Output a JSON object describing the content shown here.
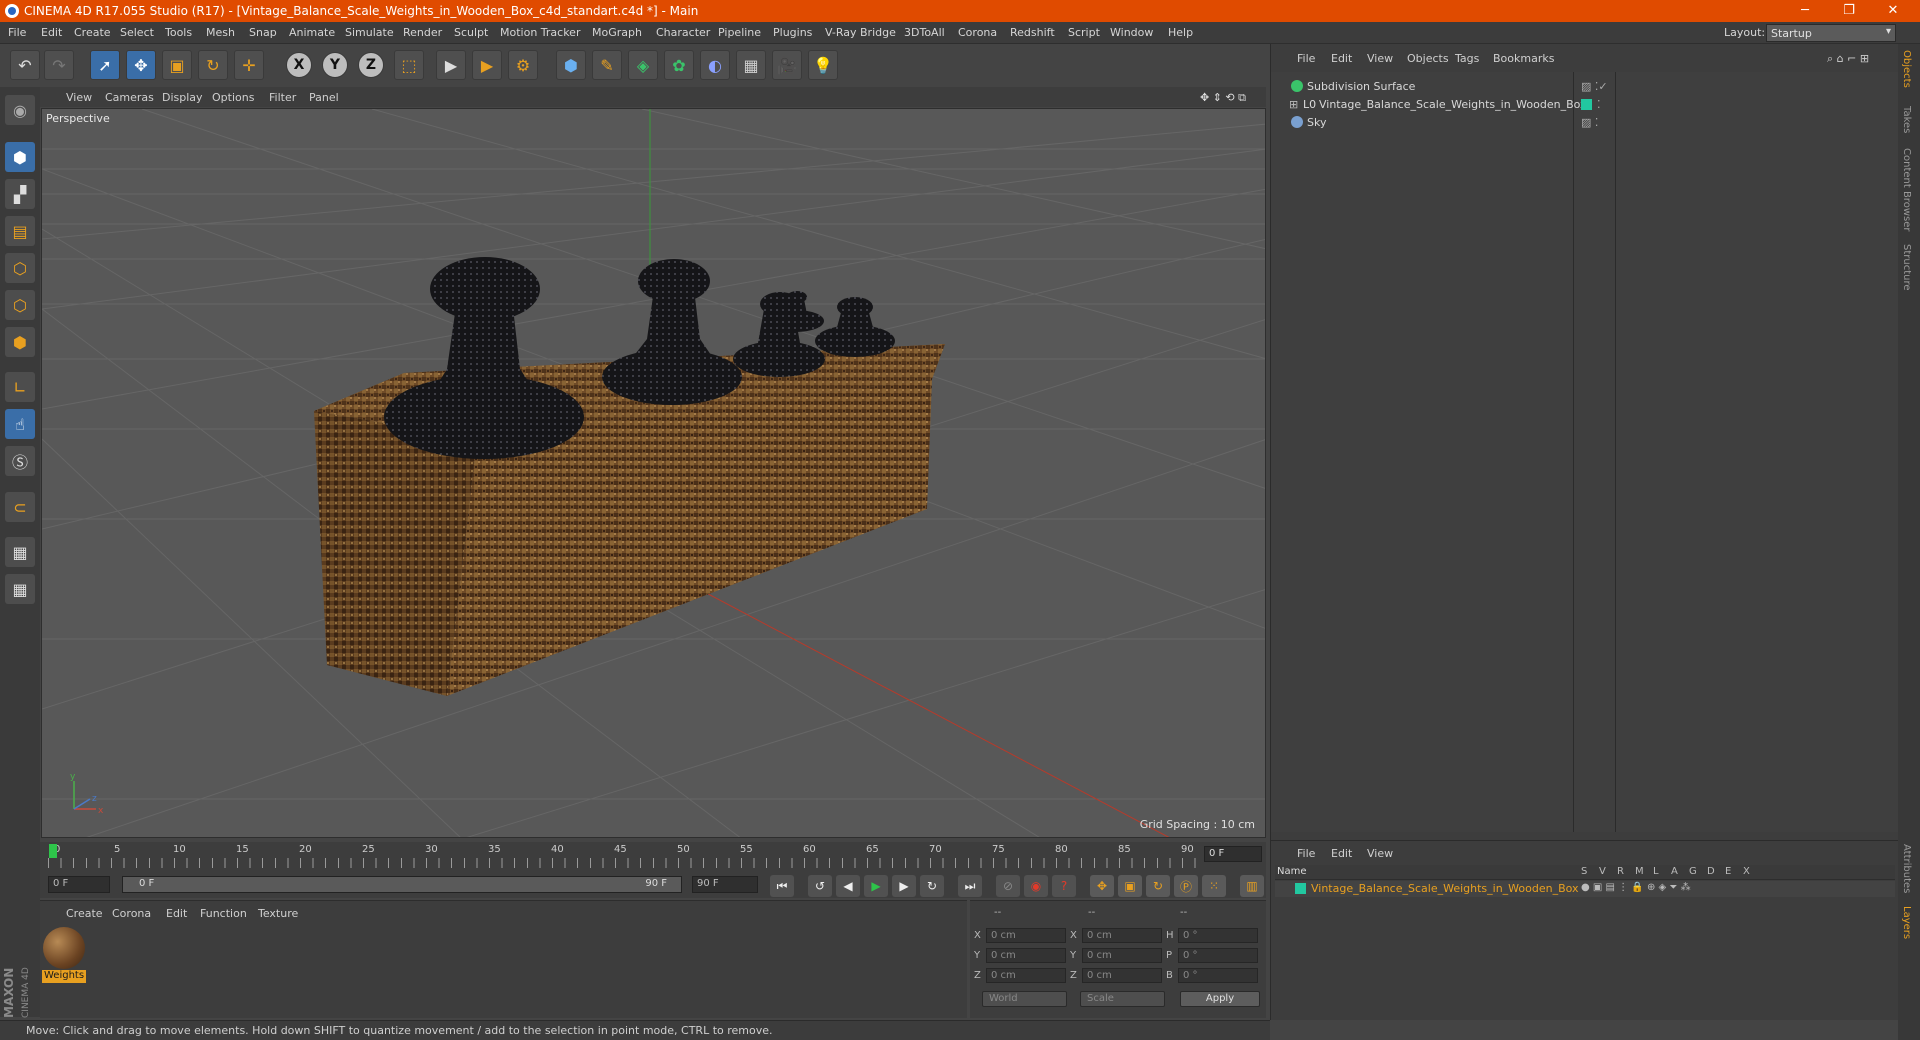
{
  "window": {
    "title": "CINEMA 4D R17.055 Studio (R17) - [Vintage_Balance_Scale_Weights_in_Wooden_Box_c4d_standart.c4d *] - Main"
  },
  "menubar": {
    "items": [
      "File",
      "Edit",
      "Create",
      "Select",
      "Tools",
      "Mesh",
      "Snap",
      "Animate",
      "Simulate",
      "Render",
      "Sculpt",
      "Motion Tracker",
      "MoGraph",
      "Character",
      "Pipeline",
      "Plugins",
      "V-Ray Bridge",
      "3DToAll",
      "Corona",
      "Redshift",
      "Script",
      "Window",
      "Help"
    ],
    "layout_label": "Layout:",
    "layout_value": "Startup"
  },
  "viewport": {
    "menu": [
      "View",
      "Cameras",
      "Display",
      "Options",
      "Filter",
      "Panel"
    ],
    "label": "Perspective",
    "grid_spacing": "Grid Spacing : 10 cm"
  },
  "timeline": {
    "ticks": [
      "0",
      "5",
      "10",
      "15",
      "20",
      "25",
      "30",
      "35",
      "40",
      "45",
      "50",
      "55",
      "60",
      "65",
      "70",
      "75",
      "80",
      "85",
      "90"
    ],
    "current_frame": "0 F"
  },
  "transport": {
    "start_field": "0 F",
    "range_start": "0 F",
    "range_end": "90 F",
    "end_field": "90 F"
  },
  "material_panel": {
    "menu": [
      "Create",
      "Corona",
      "Edit",
      "Function",
      "Texture"
    ],
    "material_name": "Weights"
  },
  "coord_panel": {
    "headers": [
      "--",
      "--",
      "--"
    ],
    "rows": [
      {
        "a_label": "X",
        "a_val": "0 cm",
        "b_label": "X",
        "b_val": "0 cm",
        "c_label": "H",
        "c_val": "0 °"
      },
      {
        "a_label": "Y",
        "a_val": "0 cm",
        "b_label": "Y",
        "b_val": "0 cm",
        "c_label": "P",
        "c_val": "0 °"
      },
      {
        "a_label": "Z",
        "a_val": "0 cm",
        "b_label": "Z",
        "b_val": "0 cm",
        "c_label": "B",
        "c_val": "0 °"
      }
    ],
    "world_dropdown": "World",
    "scale_dropdown": "Scale",
    "apply_label": "Apply"
  },
  "status": "Move: Click and drag to move elements. Hold down SHIFT to quantize movement / add to the selection in point mode, CTRL to remove.",
  "object_manager": {
    "menu": [
      "File",
      "Edit",
      "View",
      "Objects",
      "Tags",
      "Bookmarks"
    ],
    "objects": [
      {
        "name": "Subdivision Surface",
        "color": "#3ac46a"
      },
      {
        "name": "Vintage_Balance_Scale_Weights_in_Wooden_Box",
        "color": "#d0d0d0"
      },
      {
        "name": "Sky",
        "color": "#7aa0d0"
      }
    ]
  },
  "layer_manager": {
    "menu": [
      "File",
      "Edit",
      "View"
    ],
    "columns": [
      "Name",
      "S",
      "V",
      "R",
      "M",
      "L",
      "A",
      "G",
      "D",
      "E",
      "X"
    ],
    "layer_name": "Vintage_Balance_Scale_Weights_in_Wooden_Box",
    "layer_color": "#22c8a0"
  },
  "side_tabs": [
    "Objects",
    "Takes",
    "Content Browser",
    "Structure"
  ],
  "side_tabs_bottom": [
    "Attributes",
    "Layers"
  ],
  "branding": "MAXON CINEMA 4D"
}
